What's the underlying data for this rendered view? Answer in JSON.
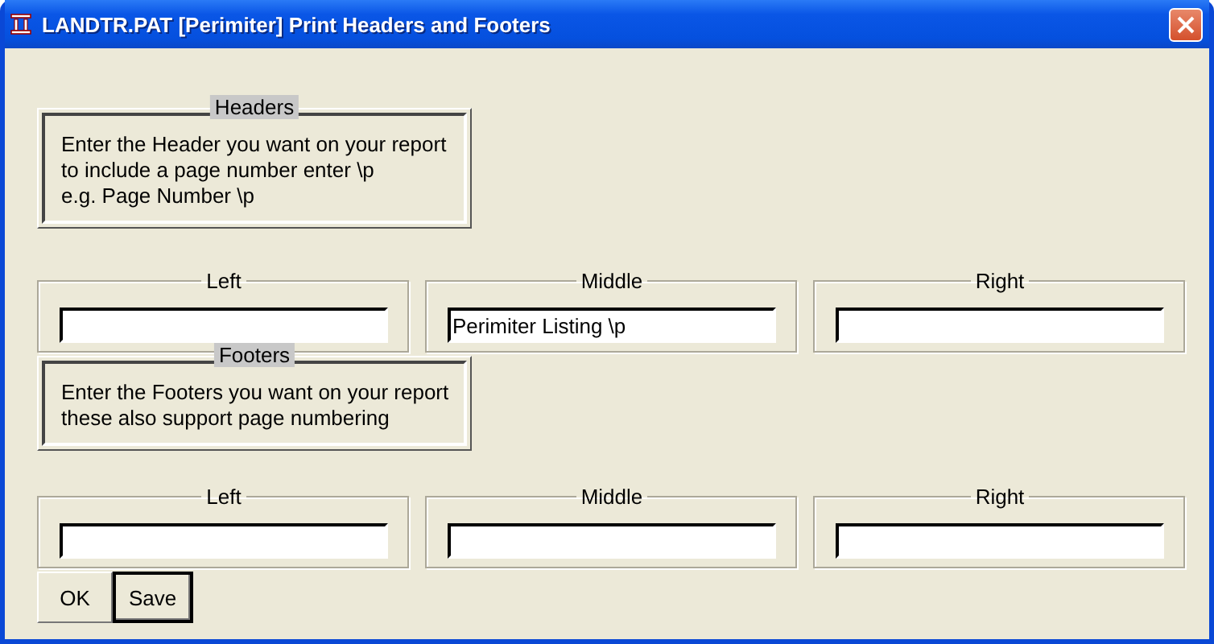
{
  "window": {
    "title": "LANDTR.PAT [Perimiter] Print Headers and Footers"
  },
  "sections": [
    {
      "title": "Headers",
      "lines": [
        "Enter the Header you want on your report",
        "to include a page number enter \\p",
        "e.g. Page Number \\p"
      ],
      "fields": [
        {
          "label": "Left"
        },
        {
          "label": "Middle",
          "value": "Perimiter Listing \\p"
        },
        {
          "label": "Right"
        }
      ]
    },
    {
      "title": "Footers",
      "lines": [
        "Enter the Footers you want on your report",
        "these also support page numbering"
      ],
      "fields": [
        {
          "label": "Left"
        },
        {
          "label": "Middle"
        },
        {
          "label": "Right"
        }
      ]
    }
  ],
  "buttons": [
    {
      "label": "OK",
      "focused": false
    },
    {
      "label": "Save",
      "focused": true
    }
  ]
}
